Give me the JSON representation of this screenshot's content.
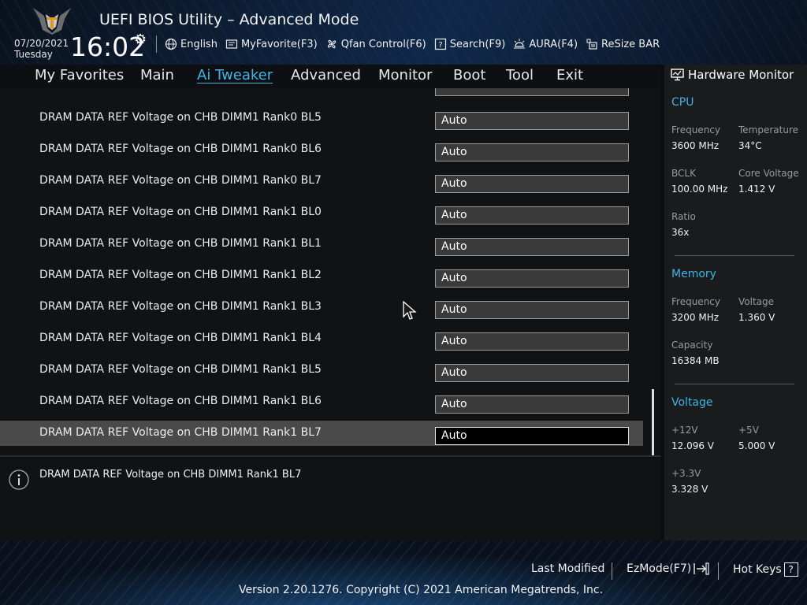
{
  "header": {
    "title": "UEFI BIOS Utility – Advanced Mode",
    "date": "07/20/2021",
    "day": "Tuesday",
    "time": "16:02",
    "toolbar": [
      {
        "label": "English",
        "icon": "globe-icon"
      },
      {
        "label": "MyFavorite(F3)",
        "icon": "favorite-icon"
      },
      {
        "label": "Qfan Control(F6)",
        "icon": "fan-icon"
      },
      {
        "label": "Search(F9)",
        "icon": "search-icon"
      },
      {
        "label": "AURA(F4)",
        "icon": "aura-icon"
      },
      {
        "label": "ReSize BAR",
        "icon": "resize-bar-icon"
      }
    ]
  },
  "menu": {
    "items": [
      "My Favorites",
      "Main",
      "Ai Tweaker",
      "Advanced",
      "Monitor",
      "Boot",
      "Tool",
      "Exit"
    ],
    "active": "Ai Tweaker"
  },
  "settings": {
    "rows": [
      {
        "label": "DRAM DATA REF Voltage on CHB DIMM1 Rank0 BL5",
        "value": "Auto"
      },
      {
        "label": "DRAM DATA REF Voltage on CHB DIMM1 Rank0 BL6",
        "value": "Auto"
      },
      {
        "label": "DRAM DATA REF Voltage on CHB DIMM1 Rank0 BL7",
        "value": "Auto"
      },
      {
        "label": "DRAM DATA REF Voltage on CHB DIMM1 Rank1 BL0",
        "value": "Auto"
      },
      {
        "label": "DRAM DATA REF Voltage on CHB DIMM1 Rank1 BL1",
        "value": "Auto"
      },
      {
        "label": "DRAM DATA REF Voltage on CHB DIMM1 Rank1 BL2",
        "value": "Auto"
      },
      {
        "label": "DRAM DATA REF Voltage on CHB DIMM1 Rank1 BL3",
        "value": "Auto"
      },
      {
        "label": "DRAM DATA REF Voltage on CHB DIMM1 Rank1 BL4",
        "value": "Auto"
      },
      {
        "label": "DRAM DATA REF Voltage on CHB DIMM1 Rank1 BL5",
        "value": "Auto"
      },
      {
        "label": "DRAM DATA REF Voltage on CHB DIMM1 Rank1 BL6",
        "value": "Auto"
      },
      {
        "label": "DRAM DATA REF Voltage on CHB DIMM1 Rank1 BL7",
        "value": "Auto"
      }
    ],
    "selected_index": 10
  },
  "help": {
    "text": "DRAM DATA REF Voltage on CHB DIMM1 Rank1 BL7"
  },
  "hardware_monitor": {
    "title": "Hardware Monitor",
    "cpu": {
      "heading": "CPU",
      "frequency_label": "Frequency",
      "frequency": "3600 MHz",
      "temperature_label": "Temperature",
      "temperature": "34°C",
      "bclk_label": "BCLK",
      "bclk": "100.00 MHz",
      "core_voltage_label": "Core Voltage",
      "core_voltage": "1.412 V",
      "ratio_label": "Ratio",
      "ratio": "36x"
    },
    "memory": {
      "heading": "Memory",
      "frequency_label": "Frequency",
      "frequency": "3200 MHz",
      "voltage_label": "Voltage",
      "voltage": "1.360 V",
      "capacity_label": "Capacity",
      "capacity": "16384 MB"
    },
    "voltage": {
      "heading": "Voltage",
      "v12_label": "+12V",
      "v12": "12.096 V",
      "v5_label": "+5V",
      "v5": "5.000 V",
      "v33_label": "+3.3V",
      "v33": "3.328 V"
    }
  },
  "footer": {
    "last_modified": "Last Modified",
    "ezmode": "EzMode(F7)",
    "hot_keys": "Hot Keys",
    "hot_keys_icon": "?",
    "copyright": "Version 2.20.1276. Copyright (C) 2021 American Megatrends, Inc."
  },
  "colors": {
    "accent": "#3fb4e6",
    "selected_row": "#4a4a4a"
  }
}
